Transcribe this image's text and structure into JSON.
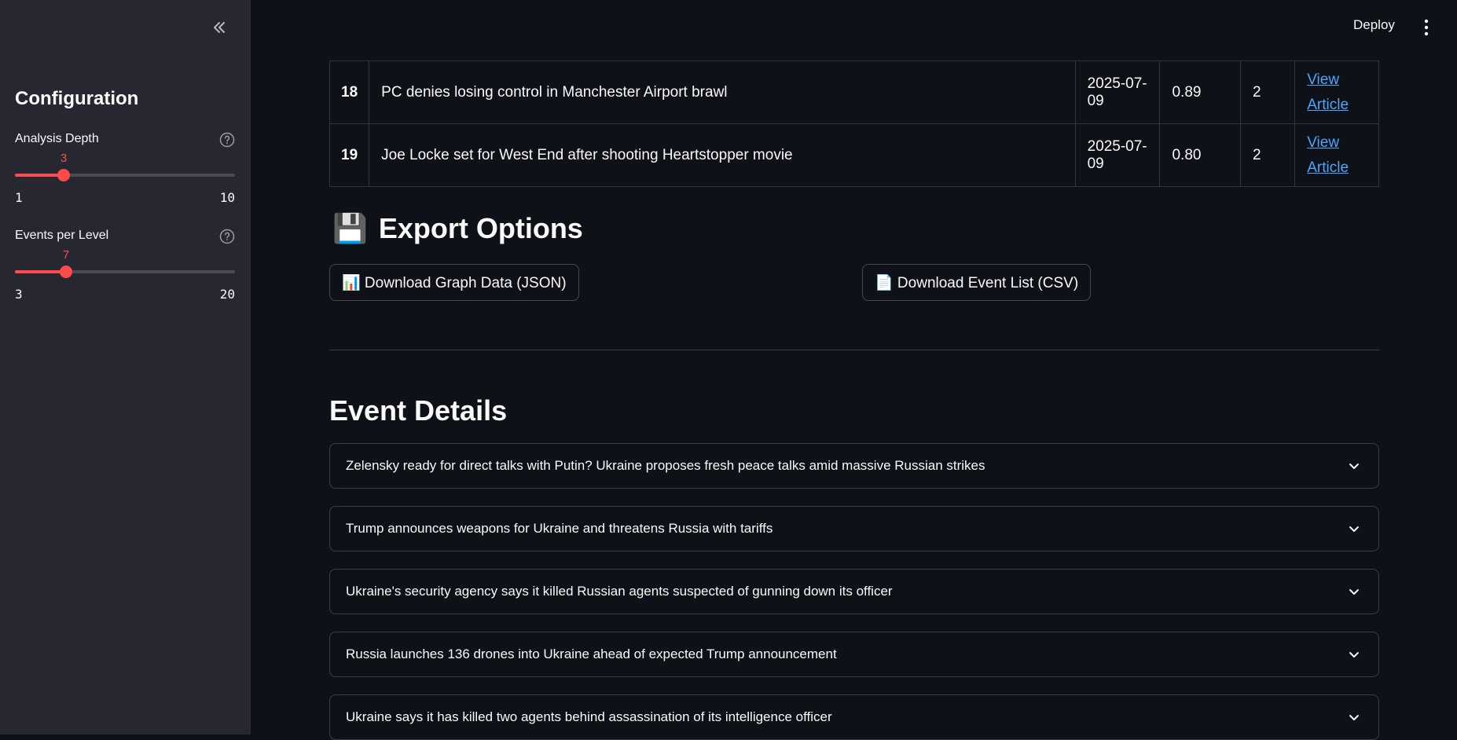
{
  "sidebar": {
    "title": "Configuration",
    "sliders": [
      {
        "label": "Analysis Depth",
        "value": "3",
        "min": "1",
        "max": "10",
        "fraction": 0.222
      },
      {
        "label": "Events per Level",
        "value": "7",
        "min": "3",
        "max": "20",
        "fraction": 0.235
      }
    ]
  },
  "header": {
    "deploy_label": "Deploy"
  },
  "table": {
    "rows": [
      {
        "idx": "18",
        "title": "PC denies losing control in Manchester Airport brawl",
        "date": "2025-07-09",
        "score": "0.89",
        "level": "2",
        "link_line1": "View",
        "link_line2": "Article"
      },
      {
        "idx": "19",
        "title": "Joe Locke set for West End after shooting Heartstopper movie",
        "date": "2025-07-09",
        "score": "0.80",
        "level": "2",
        "link_line1": "View",
        "link_line2": "Article"
      }
    ]
  },
  "export": {
    "heading": "Export Options",
    "heading_icon": "💾",
    "json_button": "📊 Download Graph Data (JSON)",
    "csv_button": "📄 Download Event List (CSV)"
  },
  "details": {
    "heading": "Event Details",
    "items": [
      "Zelensky ready for direct talks with Putin? Ukraine proposes fresh peace talks amid massive Russian strikes",
      "Trump announces weapons for Ukraine and threatens Russia with tariffs",
      "Ukraine's security agency says it killed Russian agents suspected of gunning down its officer",
      "Russia launches 136 drones into Ukraine ahead of expected Trump announcement",
      "Ukraine says it has killed two agents behind assassination of its intelligence officer"
    ]
  },
  "colors": {
    "accent": "#ff4b4b",
    "link": "#4aa6ff",
    "background": "#0e1117",
    "sidebar": "#262730"
  }
}
